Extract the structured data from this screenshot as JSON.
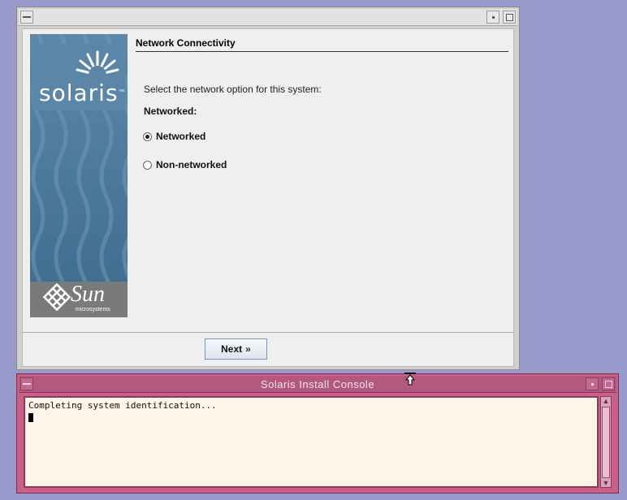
{
  "installer": {
    "page_title": "Network Connectivity",
    "prompt": "Select the network option for this system:",
    "group_label": "Networked:",
    "options": [
      {
        "label": "Networked",
        "selected": true
      },
      {
        "label": "Non-networked",
        "selected": false
      }
    ],
    "next_label": "Next",
    "next_icon": "double-chevron-right-icon",
    "banner": {
      "logo_text": "solaris",
      "tm": "™",
      "vendor_text": "Sun",
      "vendor_sub": "microsystems"
    }
  },
  "console": {
    "title": "Solaris Install Console",
    "text": "Completing system identification..."
  },
  "colors": {
    "desktop": "#9999cc",
    "console_frame": "#c9608a",
    "console_bg": "#fdf6e8",
    "banner_blue": "#4b7899"
  }
}
